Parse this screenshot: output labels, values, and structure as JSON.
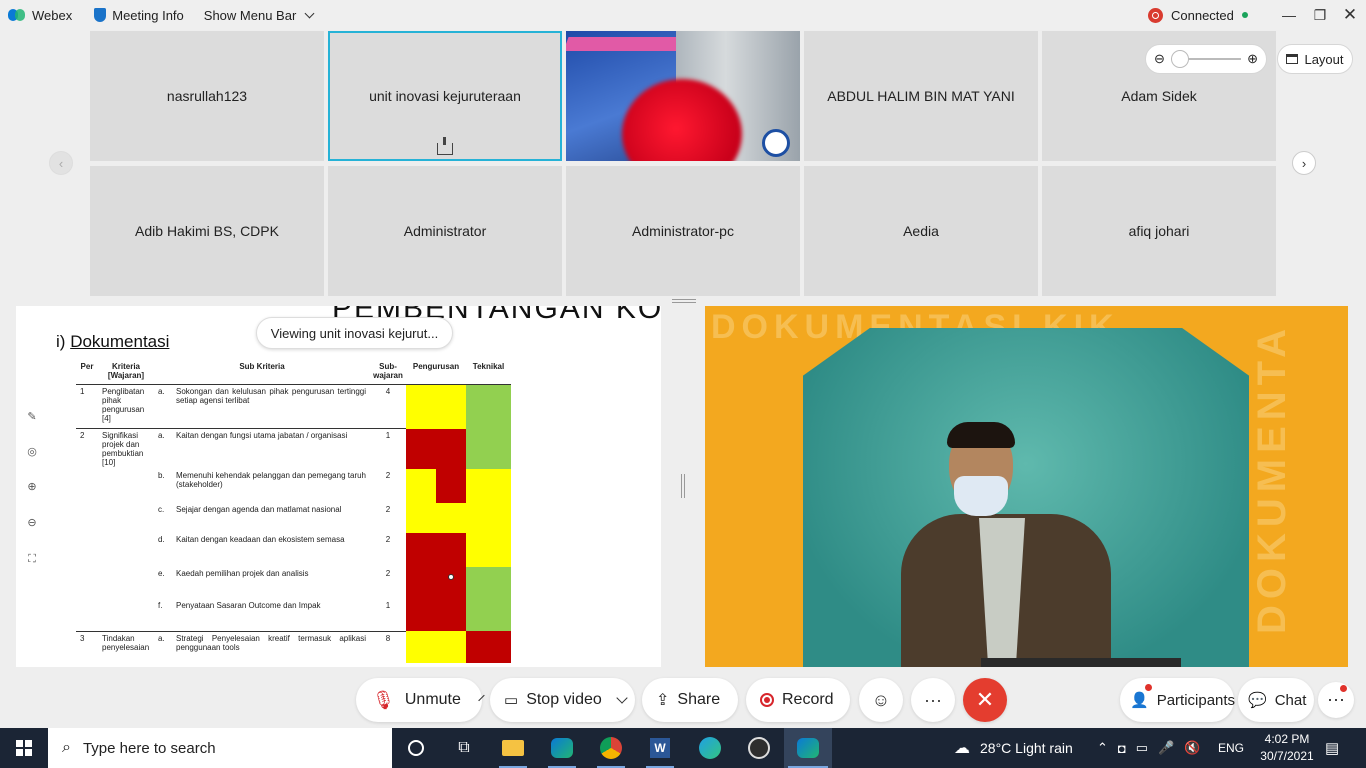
{
  "titlebar": {
    "app_name": "Webex",
    "meeting_info": "Meeting Info",
    "show_menu_bar": "Show Menu Bar",
    "status": "Connected"
  },
  "grid": {
    "tiles": [
      {
        "name": "nasrullah123"
      },
      {
        "name": "unit inovasi kejuruteraan",
        "active": true,
        "sharing": true
      },
      {
        "name": "",
        "video": true
      },
      {
        "name": "ABDUL HALIM BIN MAT YANI"
      },
      {
        "name": "Adam Sidek"
      },
      {
        "name": "Adib Hakimi BS, CDPK"
      },
      {
        "name": "Administrator"
      },
      {
        "name": "Administrator-pc"
      },
      {
        "name": "Aedia"
      },
      {
        "name": "afiq johari"
      }
    ],
    "layout_label": "Layout"
  },
  "shared": {
    "viewing_label": "Viewing unit inovasi kejurut...",
    "slide_title": "PEMBENTANGAN KONV",
    "heading_prefix": "i)",
    "heading": "Dokumentasi",
    "columns": [
      "Per",
      "Kriteria [Wajaran]",
      "Sub Kriteria",
      "Sub-wajaran",
      "Pengurusan",
      "Teknikal"
    ],
    "rows": [
      {
        "per": "1",
        "krit": "Penglibatan pihak pengurusan [4]",
        "letter": "a.",
        "sub": "Sokongan dan kelulusan pihak pengurusan tertinggi setiap agensi terlibat",
        "w": "4",
        "peng": "yellow",
        "tek": "green",
        "sep": true
      },
      {
        "per": "2",
        "krit": "Signifikasi projek dan pembuktian [10]",
        "letter": "a.",
        "sub": "Kaitan dengan fungsi utama jabatan / organisasi",
        "w": "1",
        "peng": "red",
        "tek": "green",
        "sep": true
      },
      {
        "per": "",
        "krit": "",
        "letter": "b.",
        "sub": "Memenuhi kehendak pelanggan dan pemegang taruh (stakeholder)",
        "w": "2",
        "peng": "yellow-red",
        "tek": "yellow"
      },
      {
        "per": "",
        "krit": "",
        "letter": "c.",
        "sub": "Sejajar dengan agenda dan matlamat nasional",
        "w": "2",
        "peng": "yellow",
        "tek": "yellow"
      },
      {
        "per": "",
        "krit": "",
        "letter": "d.",
        "sub": "Kaitan dengan keadaan dan ekosistem semasa",
        "w": "2",
        "peng": "red",
        "tek": "yellow"
      },
      {
        "per": "",
        "krit": "",
        "letter": "e.",
        "sub": "Kaedah pemilihan projek dan analisis",
        "w": "2",
        "peng": "red",
        "tek": "green"
      },
      {
        "per": "",
        "krit": "",
        "letter": "f.",
        "sub": "Penyataan Sasaran Outcome dan Impak",
        "w": "1",
        "peng": "red",
        "tek": "green"
      },
      {
        "per": "3",
        "krit": "Tindakan penyelesaian",
        "letter": "a.",
        "sub": "Strategi Penyelesaian kreatif termasuk aplikasi penggunaan tools",
        "w": "8",
        "peng": "yellow",
        "tek": "red",
        "sep": true
      }
    ]
  },
  "speaker": {
    "bg_text": "DOKUMENTASI KIK",
    "side_text": "DOKUMENTA"
  },
  "controls": {
    "unmute": "Unmute",
    "stop_video": "Stop video",
    "share": "Share",
    "record": "Record",
    "participants": "Participants",
    "chat": "Chat"
  },
  "taskbar": {
    "search_placeholder": "Type here to search",
    "weather": "28°C  Light rain",
    "language": "ENG",
    "time": "4:02 PM",
    "date": "30/7/2021"
  },
  "colors": {
    "accent": "#26b2d6",
    "leave": "#e43d2f",
    "yellow": "#ffff00",
    "red": "#c00000",
    "green": "#92d050"
  }
}
